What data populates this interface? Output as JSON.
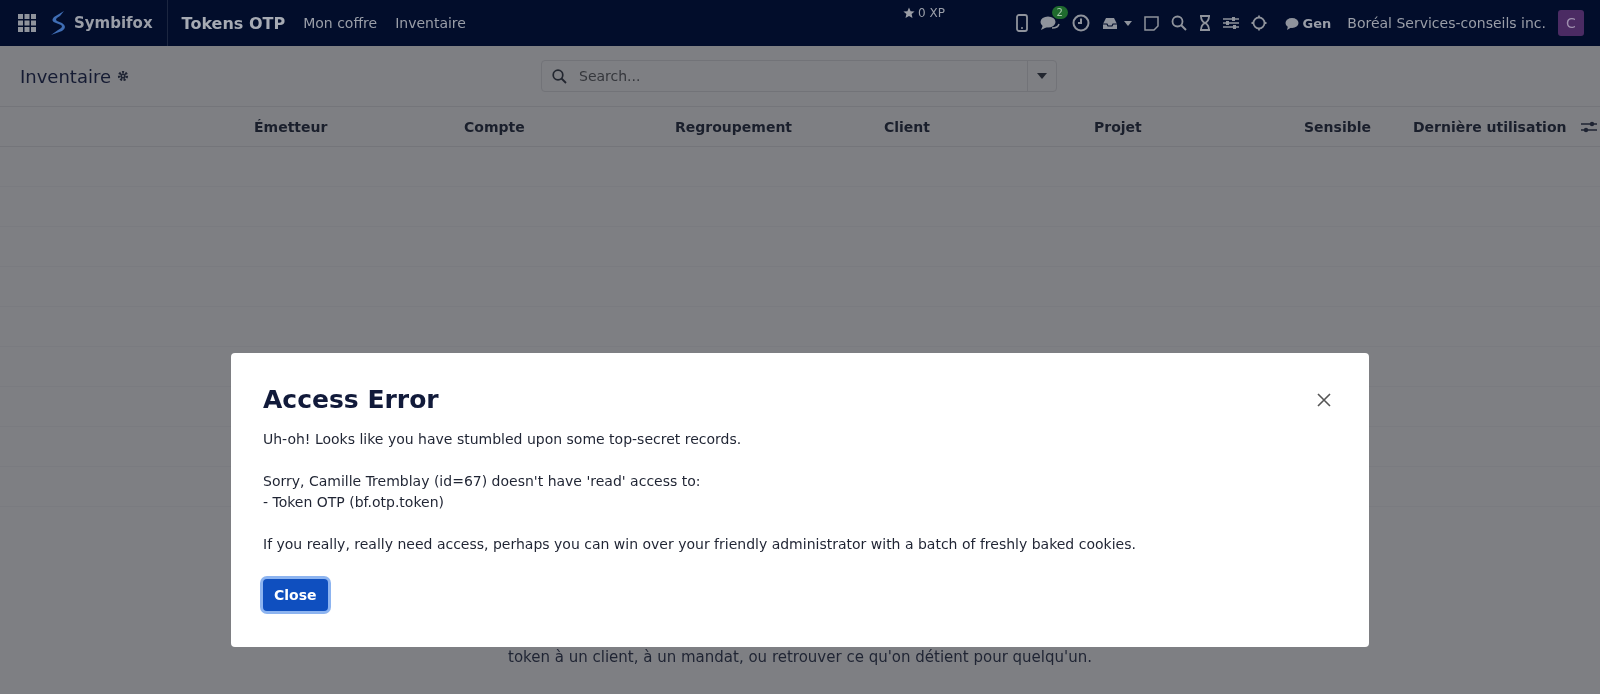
{
  "navbar": {
    "brand": "Symbifox",
    "app_title": "Tokens OTP",
    "menu": [
      {
        "label": "Mon coffre"
      },
      {
        "label": "Inventaire"
      }
    ],
    "xp": "0 XP",
    "messages_badge": "2",
    "chat_label": "Gen",
    "company": "Boréal Services-conseils inc.",
    "avatar_letter": "C"
  },
  "control_panel": {
    "title": "Inventaire",
    "search": {
      "placeholder": "Search..."
    }
  },
  "table": {
    "columns": [
      "Émetteur",
      "Compte",
      "Regroupement",
      "Client",
      "Projet",
      "Sensible",
      "Dernière utilisation"
    ]
  },
  "background_text": "token à un client, à un mandat, ou retrouver ce qu'on détient pour quelqu'un.",
  "dialog": {
    "title": "Access Error",
    "paragraphs": [
      "Uh-oh! Looks like you have stumbled upon some top-secret records.",
      "Sorry, Camille Tremblay (id=67) doesn't have 'read' access to:\n- Token OTP (bf.otp.token)",
      "If you really, really need access, perhaps you can win over your friendly administrator with a batch of freshly baked cookies."
    ],
    "button": "Close"
  }
}
